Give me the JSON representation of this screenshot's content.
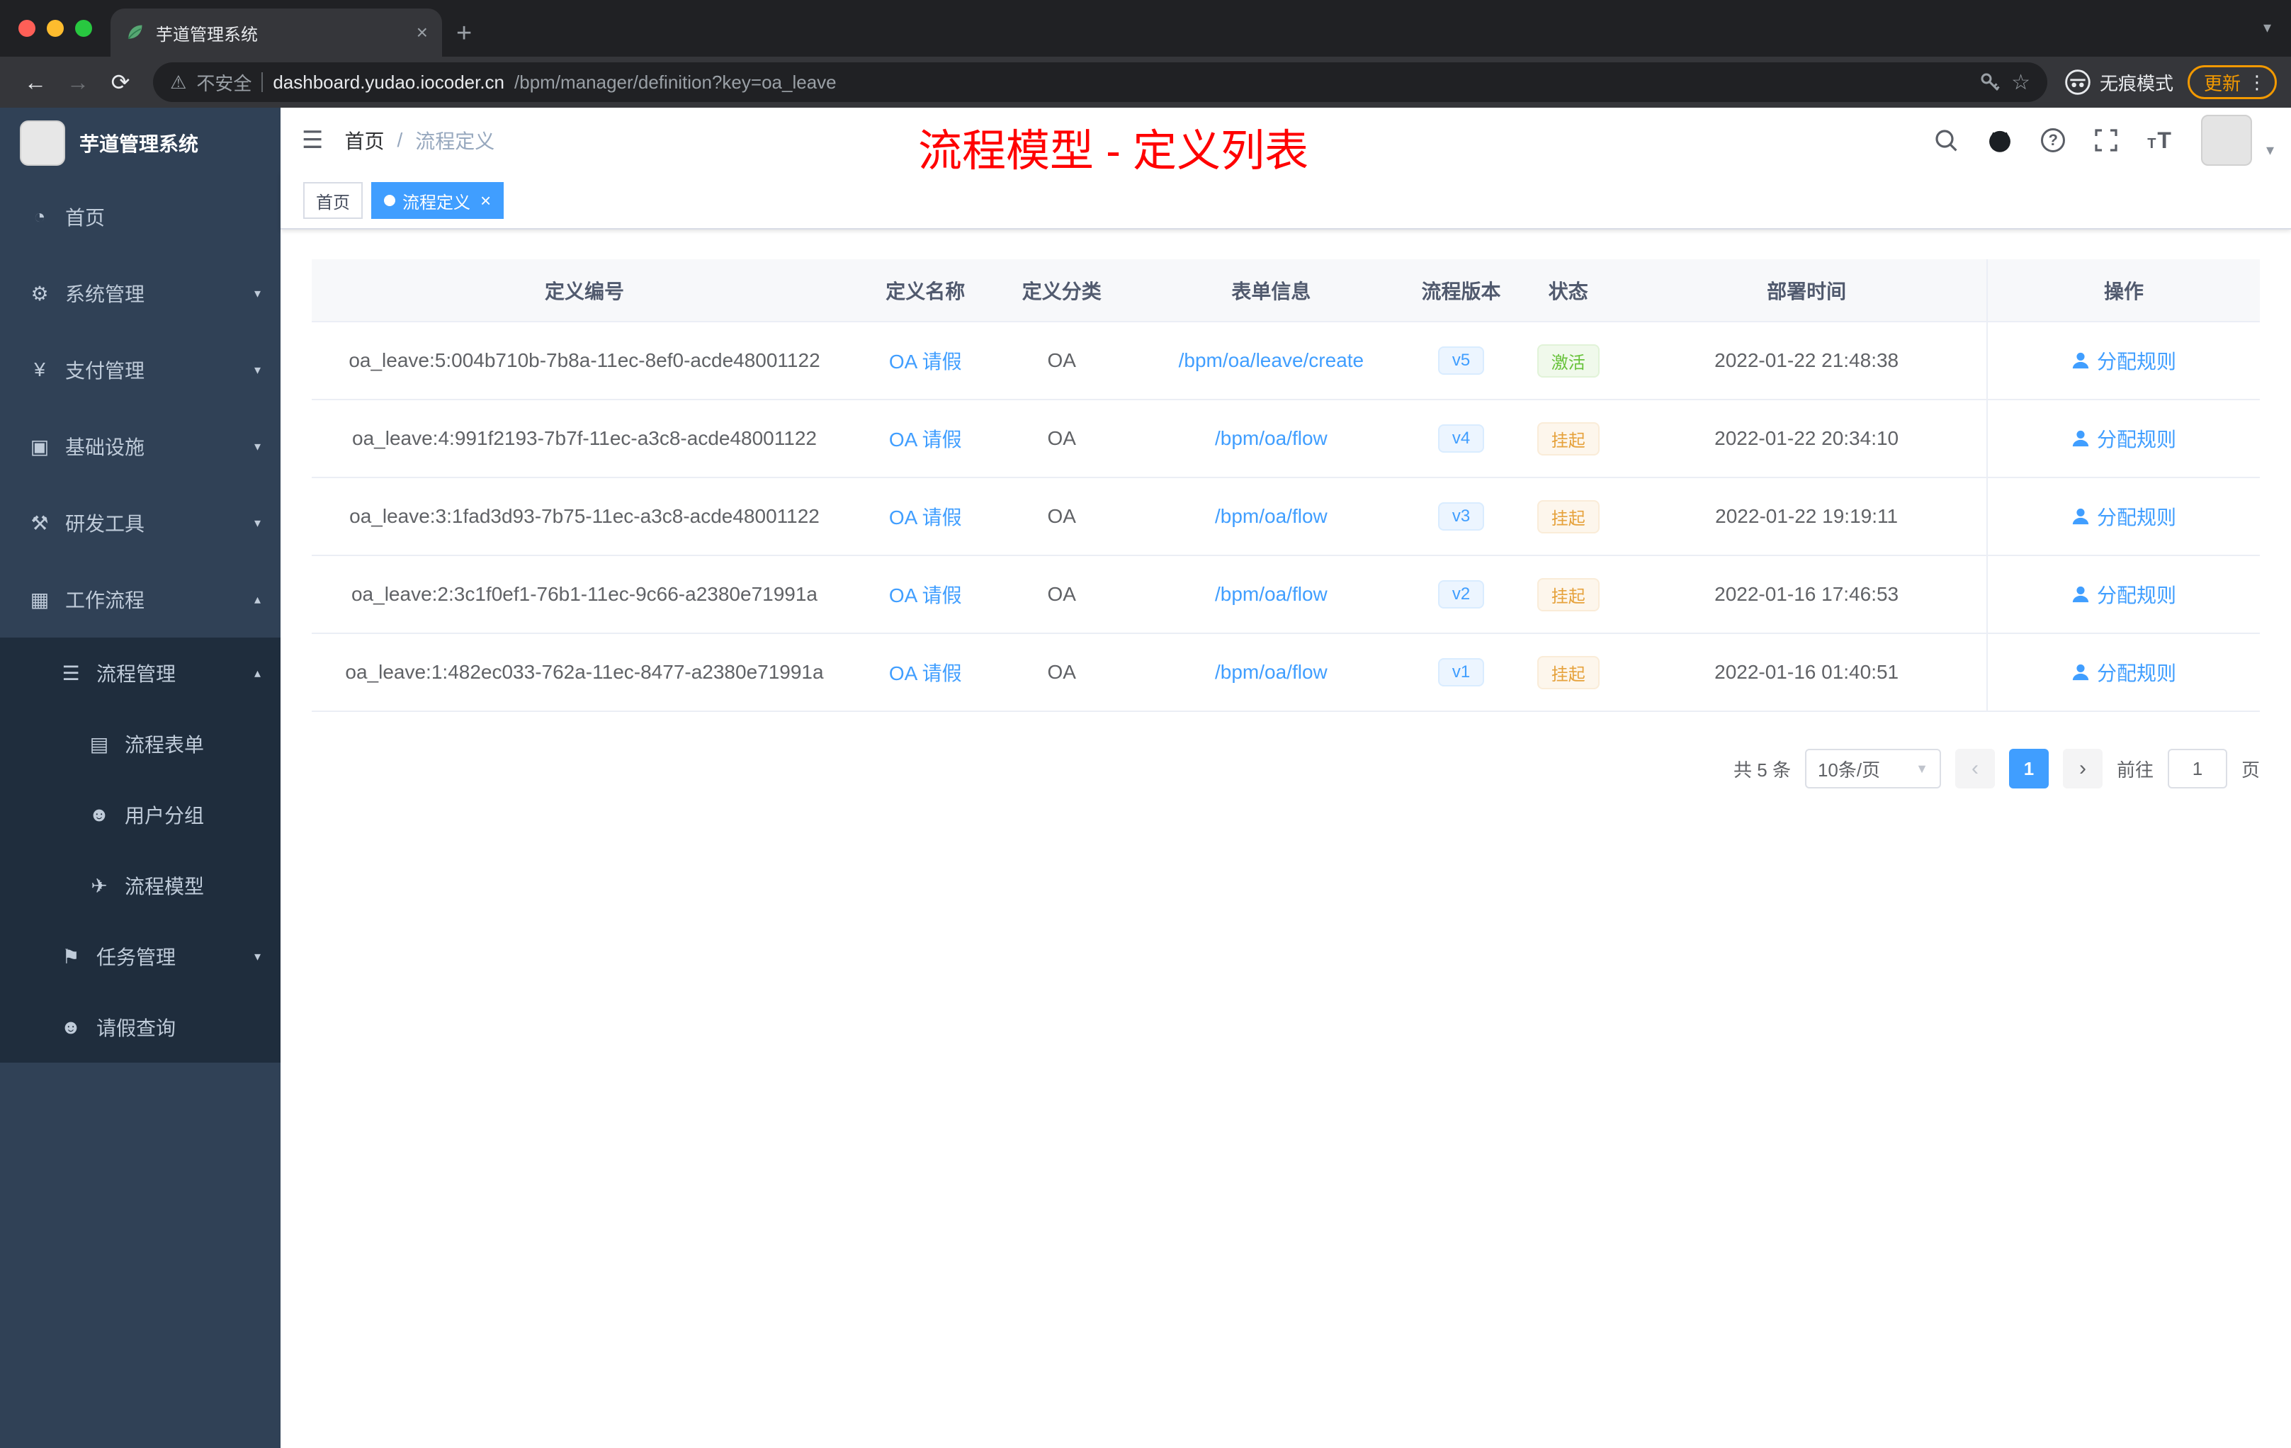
{
  "browser": {
    "tab_title": "芋道管理系统",
    "security_warning": "不安全",
    "url_host": "dashboard.yudao.iocoder.cn",
    "url_path": "/bpm/manager/definition?key=oa_leave",
    "incognito_label": "无痕模式",
    "update_label": "更新"
  },
  "sidebar": {
    "brand": "芋道管理系统",
    "items": [
      {
        "label": "首页"
      },
      {
        "label": "系统管理"
      },
      {
        "label": "支付管理"
      },
      {
        "label": "基础设施"
      },
      {
        "label": "研发工具"
      },
      {
        "label": "工作流程"
      },
      {
        "label": "流程管理"
      },
      {
        "label": "流程表单"
      },
      {
        "label": "用户分组"
      },
      {
        "label": "流程模型"
      },
      {
        "label": "任务管理"
      },
      {
        "label": "请假查询"
      }
    ]
  },
  "header": {
    "breadcrumb_home": "首页",
    "breadcrumb_sep": "/",
    "breadcrumb_current": "流程定义",
    "annotation": "流程模型 - 定义列表"
  },
  "tags": {
    "home": "首页",
    "active": "流程定义"
  },
  "table": {
    "columns": [
      "定义编号",
      "定义名称",
      "定义分类",
      "表单信息",
      "流程版本",
      "状态",
      "部署时间",
      "操作"
    ],
    "rows": [
      {
        "id": "oa_leave:5:004b710b-7b8a-11ec-8ef0-acde48001122",
        "name": "OA 请假",
        "category": "OA",
        "form": "/bpm/oa/leave/create",
        "version": "v5",
        "status": "激活",
        "status_type": "success",
        "time": "2022-01-22 21:48:38",
        "action": "分配规则"
      },
      {
        "id": "oa_leave:4:991f2193-7b7f-11ec-a3c8-acde48001122",
        "name": "OA 请假",
        "category": "OA",
        "form": "/bpm/oa/flow",
        "version": "v4",
        "status": "挂起",
        "status_type": "warning",
        "time": "2022-01-22 20:34:10",
        "action": "分配规则"
      },
      {
        "id": "oa_leave:3:1fad3d93-7b75-11ec-a3c8-acde48001122",
        "name": "OA 请假",
        "category": "OA",
        "form": "/bpm/oa/flow",
        "version": "v3",
        "status": "挂起",
        "status_type": "warning",
        "time": "2022-01-22 19:19:11",
        "action": "分配规则"
      },
      {
        "id": "oa_leave:2:3c1f0ef1-76b1-11ec-9c66-a2380e71991a",
        "name": "OA 请假",
        "category": "OA",
        "form": "/bpm/oa/flow",
        "version": "v2",
        "status": "挂起",
        "status_type": "warning",
        "time": "2022-01-16 17:46:53",
        "action": "分配规则"
      },
      {
        "id": "oa_leave:1:482ec033-762a-11ec-8477-a2380e71991a",
        "name": "OA 请假",
        "category": "OA",
        "form": "/bpm/oa/flow",
        "version": "v1",
        "status": "挂起",
        "status_type": "warning",
        "time": "2022-01-16 01:40:51",
        "action": "分配规则"
      }
    ]
  },
  "pagination": {
    "total": "共 5 条",
    "page_size": "10条/页",
    "current_page": "1",
    "goto_label": "前往",
    "goto_value": "1",
    "page_unit": "页"
  },
  "colors": {
    "accent": "#409eff",
    "success": "#67c23a",
    "warning": "#e6a23c",
    "sidebar_bg": "#304156",
    "sidebar_submenu_bg": "#1f2d3d",
    "annotation_red": "#ff0000",
    "update_orange": "#f29900"
  }
}
